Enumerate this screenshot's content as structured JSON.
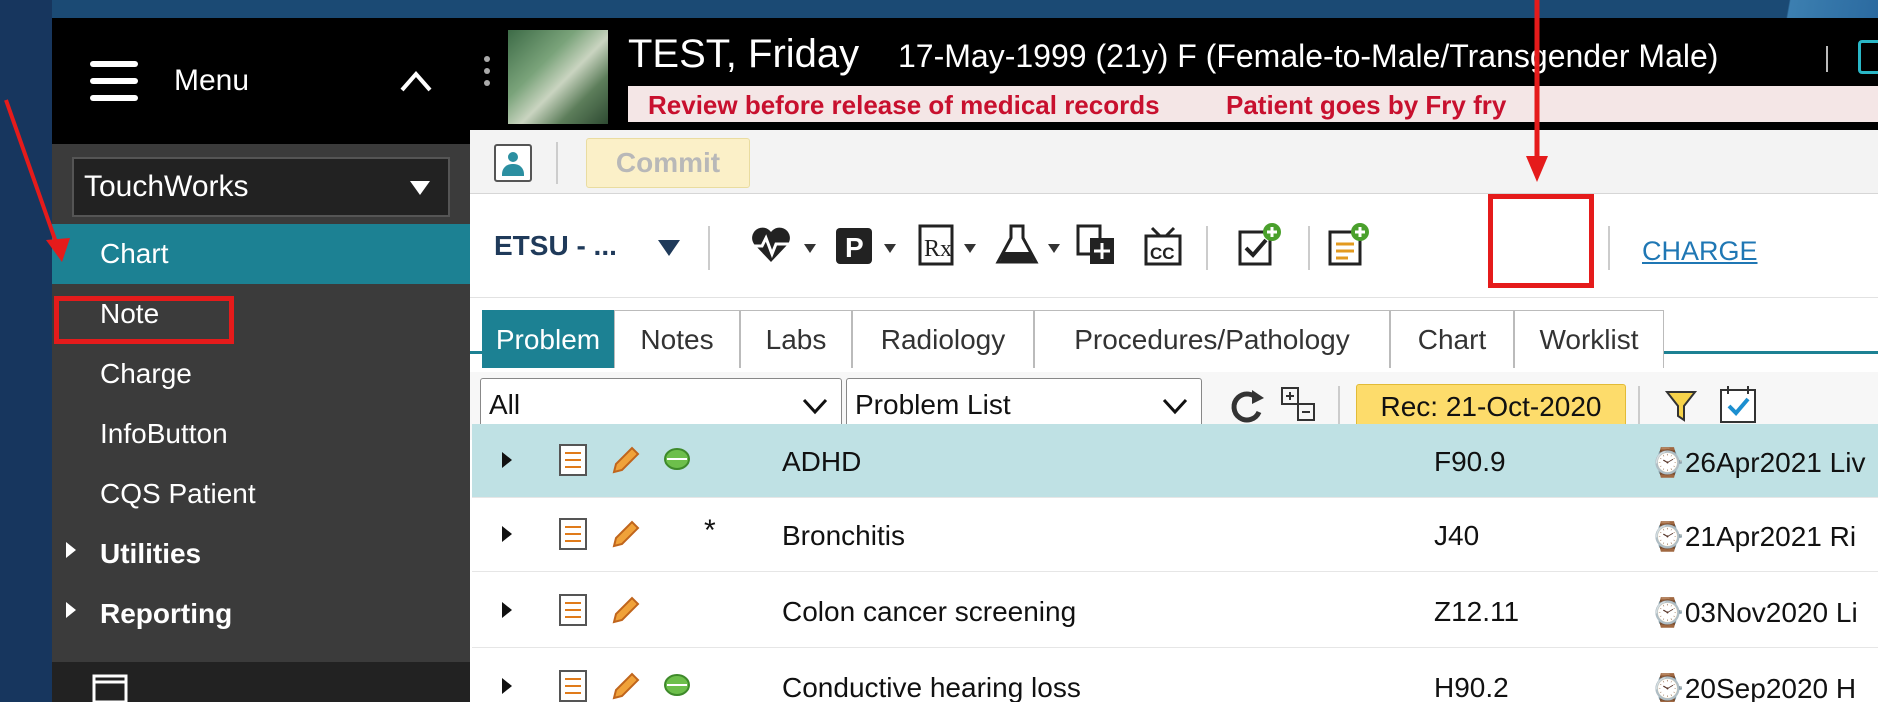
{
  "sidebar": {
    "menu_label": "Menu",
    "app_select": "TouchWorks",
    "items": [
      {
        "label": "Chart",
        "active": true
      },
      {
        "label": "Note"
      },
      {
        "label": "Charge"
      },
      {
        "label": "InfoButton"
      },
      {
        "label": "CQS Patient"
      }
    ],
    "groups": [
      {
        "label": "Utilities"
      },
      {
        "label": "Reporting"
      }
    ]
  },
  "banner": {
    "patient_name": "TEST, Friday",
    "patient_info": "17-May-1999 (21y) F (Female-to-Male/Transgender Male)",
    "alert_1": "Review before release of medical records",
    "alert_2": "Patient goes by Fry fry"
  },
  "commit_label": "Commit",
  "toolbar": {
    "org_select": "ETSU - ...",
    "charge_link": "CHARGE"
  },
  "tabs": [
    {
      "label": "Problem",
      "active": true
    },
    {
      "label": "Notes"
    },
    {
      "label": "Labs"
    },
    {
      "label": "Radiology"
    },
    {
      "label": "Procedures/Pathology"
    },
    {
      "label": "Chart"
    },
    {
      "label": "Worklist"
    }
  ],
  "filters": {
    "scope": "All",
    "list": "Problem List",
    "rec_badge": "Rec: 21-Oct-2020"
  },
  "problems": [
    {
      "name": "ADHD",
      "code": "F90.9",
      "date": "⌚26Apr2021 Liv",
      "status_icon": "green-oval-icon",
      "star": ""
    },
    {
      "name": "Bronchitis",
      "code": "J40",
      "date": "⌚21Apr2021 Ri",
      "status_icon": "",
      "star": "*"
    },
    {
      "name": "Colon cancer screening",
      "code": "Z12.11",
      "date": "⌚03Nov2020 Li",
      "status_icon": "",
      "star": ""
    },
    {
      "name": "Conductive hearing loss",
      "code": "H90.2",
      "date": "⌚20Sep2020 H",
      "status_icon": "green-oval-icon",
      "star": ""
    }
  ],
  "colors": {
    "accent_teal": "#1c8193",
    "annotation_red": "#e51b1b",
    "alert_red": "#c8102e",
    "rec_yellow": "#fddc6b"
  }
}
